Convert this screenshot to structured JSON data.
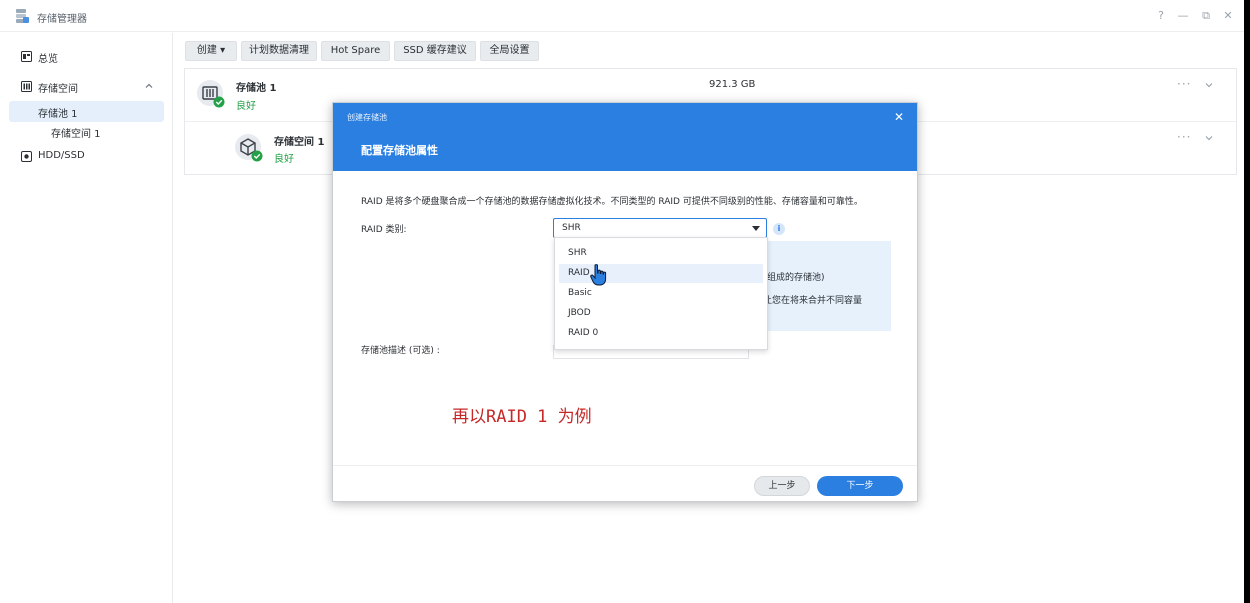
{
  "app": {
    "title": "存储管理器",
    "window_controls": [
      "?",
      "—",
      "⧉",
      "✕"
    ]
  },
  "sidebar": {
    "items": [
      {
        "label": "总览",
        "icon": "overview-icon"
      },
      {
        "label": "存储空间",
        "icon": "storage-icon",
        "expanded": true
      },
      {
        "label": "存储池 1",
        "active": true
      },
      {
        "label": "存储空间 1"
      },
      {
        "label": "HDD/SSD",
        "icon": "disk-icon"
      }
    ]
  },
  "toolbar": {
    "create": "创建",
    "schedule_scrub": "计划数据清理",
    "hot_spare": "Hot Spare",
    "ssd_cache": "SSD 缓存建议",
    "global_settings": "全局设置"
  },
  "pool": {
    "name": "存储池 1",
    "status": "良好",
    "size": "921.3 GB",
    "volume_name": "存储空间 1",
    "volume_status": "良好",
    "more": "···"
  },
  "dialog": {
    "small_title": "创建存储池",
    "close": "✕",
    "title": "配置存储池属性",
    "description": "RAID 是将多个硬盘聚合成一个存储池的数据存储虚拟化技术。不同类型的 RAID 可提供不同级别的性能、存储容量和可靠性。",
    "raid_label": "RAID 类别:",
    "raid_value": "SHR",
    "info_icon": "i",
    "info_line1": "组成的存储池)",
    "info_line2": "让您在将来合并不同容量",
    "pool_desc_label": "存储池描述 (可选) :",
    "raid_options": [
      "SHR",
      "RAID",
      "Basic",
      "JBOD",
      "RAID 0"
    ],
    "prev": "上一步",
    "next": "下一步"
  },
  "annotation": "再以RAID 1 为例",
  "colors": {
    "accent": "#2a7fe1",
    "ok": "#24a148",
    "annotation": "#c62828"
  }
}
